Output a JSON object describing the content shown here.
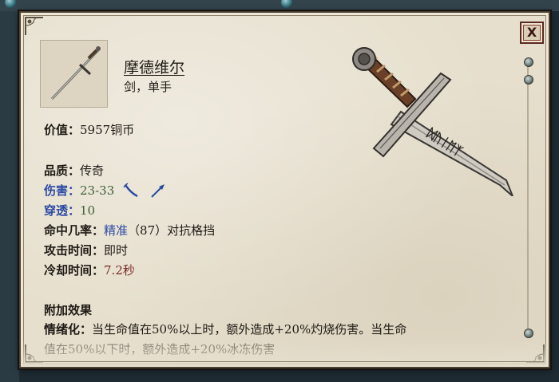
{
  "item": {
    "name": "摩德维尔",
    "type": "剑，单手",
    "value_label": "价值：",
    "value": "5957铜币"
  },
  "stats": {
    "quality_label": "品质：",
    "quality": "传奇",
    "damage_label": "伤害：",
    "damage": "23-33",
    "damage_type_icons": [
      "slash-icon",
      "pierce-icon"
    ],
    "penetration_label": "穿透：",
    "penetration": "10",
    "accuracy_label": "命中几率：",
    "accuracy_value": "精准",
    "accuracy_number": "（87）",
    "accuracy_suffix": "对抗格挡",
    "attack_time_label": "攻击时间：",
    "attack_time": "即时",
    "cooldown_label": "冷却时间：",
    "cooldown": "7.2秒"
  },
  "effects": {
    "heading": "附加效果",
    "line1_label": "情绪化：",
    "line1_text": "当生命值在50%以上时，额外造成+20%灼烧伤害。当生命",
    "line2_text": "值在50%以下时，额外造成+20%冰冻伤害"
  },
  "controls": {
    "close_label": "X"
  },
  "colors": {
    "parchment": "#e6dfcd",
    "keyword_blue": "#2c4aa3",
    "value_green": "#3c5e3a",
    "value_red": "#7a2a24"
  }
}
